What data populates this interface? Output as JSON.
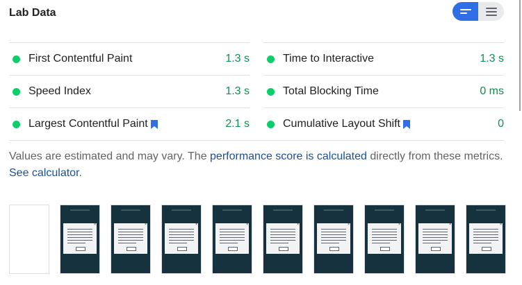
{
  "header": {
    "title": "Lab Data"
  },
  "view_toggle": {
    "options": [
      {
        "name": "metrics-view",
        "icon": "short-lines-icon",
        "active": true
      },
      {
        "name": "list-view",
        "icon": "list-lines-icon",
        "active": false
      }
    ]
  },
  "metrics": {
    "left": [
      {
        "label": "First Contentful Paint",
        "value": "1.3 s",
        "bookmark": false
      },
      {
        "label": "Speed Index",
        "value": "1.3 s",
        "bookmark": false
      },
      {
        "label": "Largest Contentful Paint",
        "value": "2.1 s",
        "bookmark": true
      }
    ],
    "right": [
      {
        "label": "Time to Interactive",
        "value": "1.3 s",
        "bookmark": false
      },
      {
        "label": "Total Blocking Time",
        "value": "0 ms",
        "bookmark": false
      },
      {
        "label": "Cumulative Layout Shift",
        "value": "0",
        "bookmark": true
      }
    ],
    "status_color": "#0cce6b",
    "value_color": "#0d904f",
    "bookmark_color": "#2f6ee6"
  },
  "description": {
    "part1": "Values are estimated and may vary. The ",
    "link1": "performance score is calculated",
    "part2": " directly from these metrics. ",
    "link2": "See calculator",
    "part3": "."
  },
  "filmstrip": {
    "frame_count": 10,
    "loaded_from": 1
  }
}
